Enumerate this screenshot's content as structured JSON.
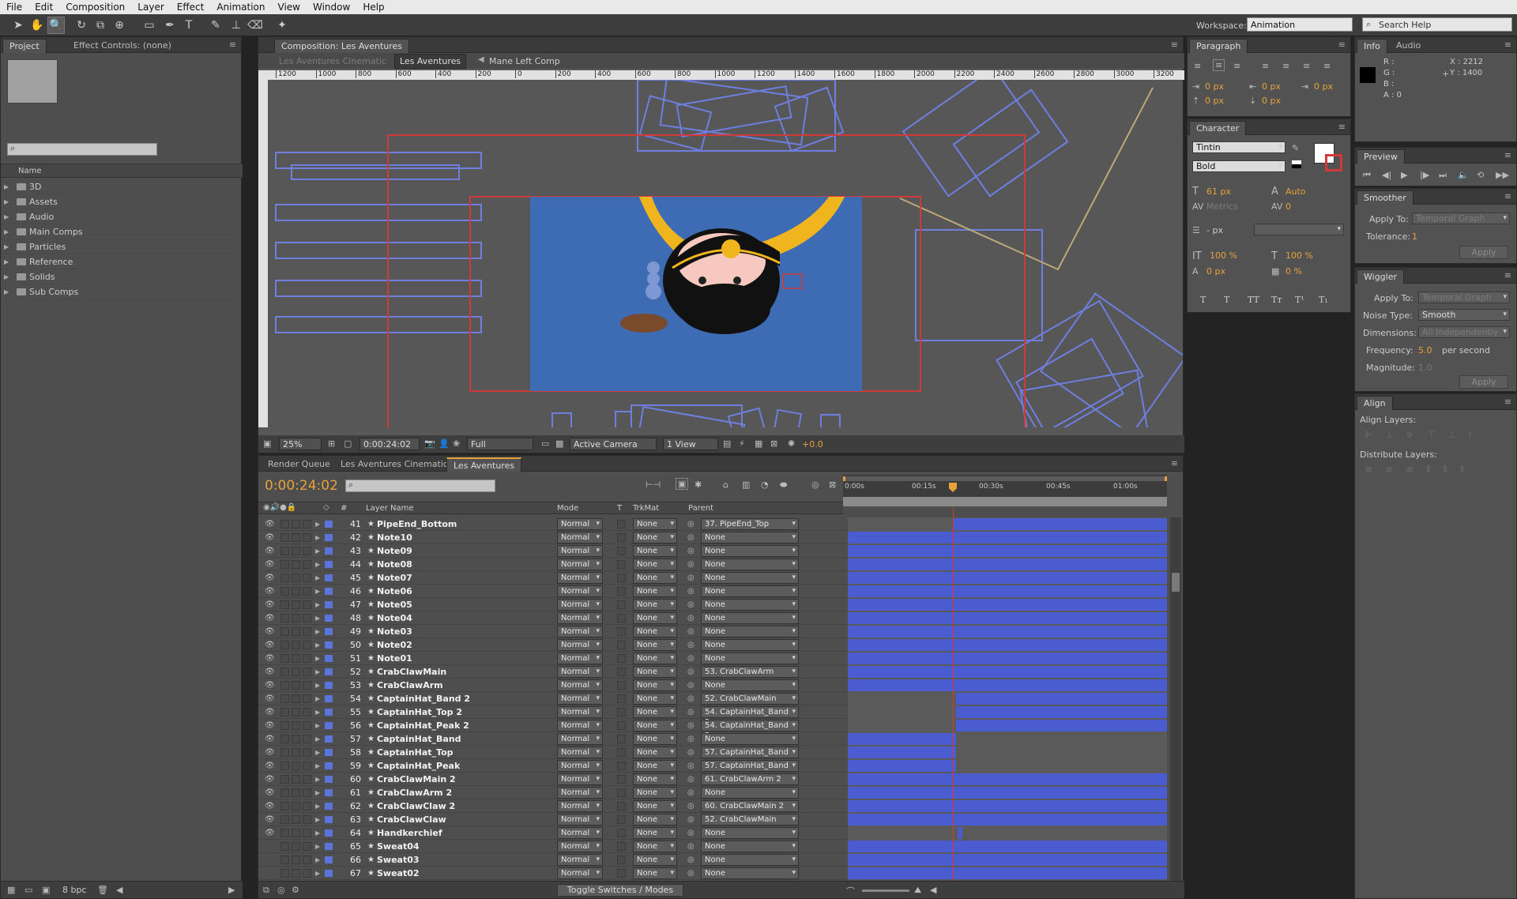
{
  "menubar": {
    "items": [
      "File",
      "Edit",
      "Composition",
      "Layer",
      "Effect",
      "Animation",
      "View",
      "Window",
      "Help"
    ]
  },
  "toolbar": {
    "workspace_label": "Workspace:",
    "workspace_value": "Animation",
    "search_placeholder": "Search Help"
  },
  "project_panel": {
    "tabs": [
      "Project",
      "Effect Controls: (none)"
    ],
    "column_header": "Name",
    "folders": [
      "3D",
      "Assets",
      "Audio",
      "Main Comps",
      "Particles",
      "Reference",
      "Solids",
      "Sub Comps"
    ],
    "bpc": "8 bpc"
  },
  "composition_panel": {
    "tab": "Composition: Les Aventures",
    "breadcrumbs": [
      "Les Aventures Cinematic",
      "Les Aventures",
      "Mane Left Comp"
    ],
    "ruler_ticks": [
      "1200",
      "1000",
      "800",
      "600",
      "400",
      "200",
      "0",
      "200",
      "400",
      "600",
      "800",
      "1000",
      "1200",
      "1400",
      "1600",
      "1800",
      "2000",
      "2200",
      "2400",
      "2600",
      "2800",
      "3000",
      "3200"
    ],
    "zoom": "25%",
    "timecode": "0:00:24:02",
    "resolution": "Full",
    "camera": "Active Camera",
    "views": "1 View",
    "exposure": "+0.0"
  },
  "timeline_panel": {
    "tabs": [
      "Render Queue",
      "Les Aventures Cinematic",
      "Les Aventures"
    ],
    "current_time": "0:00:24:02",
    "headers": {
      "layer_name": "Layer Name",
      "num": "#",
      "mode": "Mode",
      "t": "T",
      "trkmat": "TrkMat",
      "parent": "Parent"
    },
    "time_markers": [
      "0:00s",
      "00:15s",
      "00:30s",
      "00:45s",
      "01:00s"
    ],
    "toggle_label": "Toggle Switches / Modes",
    "layers": [
      {
        "num": "41",
        "name": "PipeEnd_Bottom",
        "mode": "Normal",
        "trkmat": "None",
        "parent": "37. PipeEnd_Top",
        "bar_start": 0.33,
        "bar_end": 1.0
      },
      {
        "num": "42",
        "name": "Note10",
        "mode": "Normal",
        "trkmat": "None",
        "parent": "None",
        "bar_start": 0.0,
        "bar_end": 1.0
      },
      {
        "num": "43",
        "name": "Note09",
        "mode": "Normal",
        "trkmat": "None",
        "parent": "None",
        "bar_start": 0.0,
        "bar_end": 1.0
      },
      {
        "num": "44",
        "name": "Note08",
        "mode": "Normal",
        "trkmat": "None",
        "parent": "None",
        "bar_start": 0.0,
        "bar_end": 1.0
      },
      {
        "num": "45",
        "name": "Note07",
        "mode": "Normal",
        "trkmat": "None",
        "parent": "None",
        "bar_start": 0.0,
        "bar_end": 1.0
      },
      {
        "num": "46",
        "name": "Note06",
        "mode": "Normal",
        "trkmat": "None",
        "parent": "None",
        "bar_start": 0.0,
        "bar_end": 1.0
      },
      {
        "num": "47",
        "name": "Note05",
        "mode": "Normal",
        "trkmat": "None",
        "parent": "None",
        "bar_start": 0.0,
        "bar_end": 1.0
      },
      {
        "num": "48",
        "name": "Note04",
        "mode": "Normal",
        "trkmat": "None",
        "parent": "None",
        "bar_start": 0.0,
        "bar_end": 1.0
      },
      {
        "num": "49",
        "name": "Note03",
        "mode": "Normal",
        "trkmat": "None",
        "parent": "None",
        "bar_start": 0.0,
        "bar_end": 1.0
      },
      {
        "num": "50",
        "name": "Note02",
        "mode": "Normal",
        "trkmat": "None",
        "parent": "None",
        "bar_start": 0.0,
        "bar_end": 1.0
      },
      {
        "num": "51",
        "name": "Note01",
        "mode": "Normal",
        "trkmat": "None",
        "parent": "None",
        "bar_start": 0.0,
        "bar_end": 1.0
      },
      {
        "num": "52",
        "name": "CrabClawMain",
        "mode": "Normal",
        "trkmat": "None",
        "parent": "53. CrabClawArm",
        "bar_start": 0.0,
        "bar_end": 1.0
      },
      {
        "num": "53",
        "name": "CrabClawArm",
        "mode": "Normal",
        "trkmat": "None",
        "parent": "None",
        "bar_start": 0.0,
        "bar_end": 1.0
      },
      {
        "num": "54",
        "name": "CaptainHat_Band 2",
        "mode": "Normal",
        "trkmat": "None",
        "parent": "52. CrabClawMain",
        "bar_start": 0.34,
        "bar_end": 1.0
      },
      {
        "num": "55",
        "name": "CaptainHat_Top 2",
        "mode": "Normal",
        "trkmat": "None",
        "parent": "54. CaptainHat_Band 2",
        "bar_start": 0.34,
        "bar_end": 1.0
      },
      {
        "num": "56",
        "name": "CaptainHat_Peak 2",
        "mode": "Normal",
        "trkmat": "None",
        "parent": "54. CaptainHat_Band 2",
        "bar_start": 0.34,
        "bar_end": 1.0
      },
      {
        "num": "57",
        "name": "CaptainHat_Band",
        "mode": "Normal",
        "trkmat": "None",
        "parent": "None",
        "bar_start": 0.0,
        "bar_end": 0.34
      },
      {
        "num": "58",
        "name": "CaptainHat_Top",
        "mode": "Normal",
        "trkmat": "None",
        "parent": "57. CaptainHat_Band",
        "bar_start": 0.0,
        "bar_end": 0.34
      },
      {
        "num": "59",
        "name": "CaptainHat_Peak",
        "mode": "Normal",
        "trkmat": "None",
        "parent": "57. CaptainHat_Band",
        "bar_start": 0.0,
        "bar_end": 0.34
      },
      {
        "num": "60",
        "name": "CrabClawMain 2",
        "mode": "Normal",
        "trkmat": "None",
        "parent": "61. CrabClawArm 2",
        "bar_start": 0.0,
        "bar_end": 1.0
      },
      {
        "num": "61",
        "name": "CrabClawArm 2",
        "mode": "Normal",
        "trkmat": "None",
        "parent": "None",
        "bar_start": 0.0,
        "bar_end": 1.0
      },
      {
        "num": "62",
        "name": "CrabClawClaw 2",
        "mode": "Normal",
        "trkmat": "None",
        "parent": "60. CrabClawMain 2",
        "bar_start": 0.0,
        "bar_end": 1.0
      },
      {
        "num": "63",
        "name": "CrabClawClaw",
        "mode": "Normal",
        "trkmat": "None",
        "parent": "52. CrabClawMain",
        "bar_start": 0.0,
        "bar_end": 1.0
      },
      {
        "num": "64",
        "name": "Handkerchief",
        "mode": "Normal",
        "trkmat": "None",
        "parent": "None",
        "bar_start": 0.345,
        "bar_end": 0.36
      },
      {
        "num": "65",
        "name": "Sweat04",
        "mode": "Normal",
        "trkmat": "None",
        "parent": "None",
        "bar_start": 0.0,
        "bar_end": 1.0
      },
      {
        "num": "66",
        "name": "Sweat03",
        "mode": "Normal",
        "trkmat": "None",
        "parent": "None",
        "bar_start": 0.0,
        "bar_end": 1.0
      },
      {
        "num": "67",
        "name": "Sweat02",
        "mode": "Normal",
        "trkmat": "None",
        "parent": "None",
        "bar_start": 0.0,
        "bar_end": 1.0
      }
    ]
  },
  "paragraph_panel": {
    "tab": "Paragraph",
    "fields": [
      "0 px",
      "0 px",
      "0 px",
      "0 px",
      "0 px"
    ]
  },
  "character_panel": {
    "tab": "Character",
    "font": "Tintin",
    "style": "Bold",
    "size": "61 px",
    "leading": "Auto",
    "kerning": "Metrics",
    "tracking": "0",
    "stroke": "- px",
    "vscale": "100 %",
    "hscale": "100 %",
    "baseline": "0 px",
    "tsume": "0 %",
    "style_buttons": [
      "T",
      "T",
      "TT",
      "Tт",
      "T¹",
      "T₁"
    ]
  },
  "info_panel": {
    "tabs": [
      "Info",
      "Audio"
    ],
    "r": "R :",
    "g": "G :",
    "b": "B :",
    "a": "A : 0",
    "x": "X : 2212",
    "y": "Y : 1400"
  },
  "preview_panel": {
    "tab": "Preview"
  },
  "smoother_panel": {
    "tab": "Smoother",
    "apply_to_label": "Apply To:",
    "apply_to_value": "Temporal Graph",
    "tolerance_label": "Tolerance:",
    "tolerance_value": "1",
    "apply": "Apply"
  },
  "wiggler_panel": {
    "tab": "Wiggler",
    "apply_to_label": "Apply To:",
    "apply_to_value": "Temporal Graph",
    "noise_label": "Noise Type:",
    "noise_value": "Smooth",
    "dimensions_label": "Dimensions:",
    "dimensions_value": "All Independently",
    "frequency_label": "Frequency:",
    "frequency_value": "5.0",
    "frequency_unit": "per second",
    "magnitude_label": "Magnitude:",
    "magnitude_value": "1.0",
    "apply": "Apply"
  },
  "align_panel": {
    "tab": "Align",
    "align_label": "Align Layers:",
    "distribute_label": "Distribute Layers:"
  },
  "colors": {
    "accent": "#e6a33b",
    "layer_bar": "#4a5cd0",
    "comp_bg": "#3d6cb5",
    "guide": "#6e7fe0"
  }
}
